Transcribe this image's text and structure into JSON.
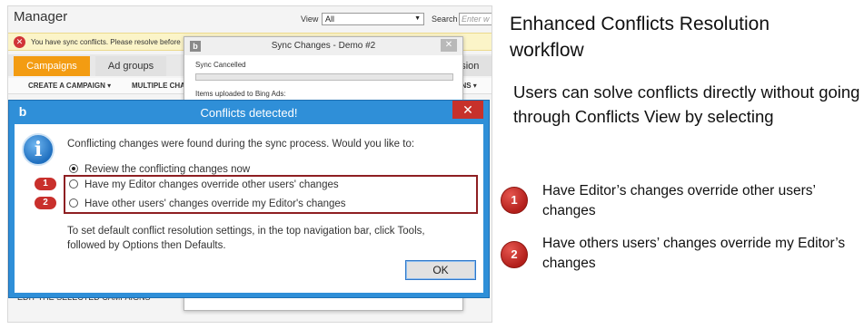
{
  "manager": {
    "title": "Manager",
    "view_label": "View",
    "view_value": "All",
    "search_label": "Search",
    "search_placeholder": "Enter w",
    "notice": "You have sync conflicts. Please resolve before",
    "tabs": [
      "Campaigns",
      "Ad groups",
      "ension"
    ],
    "toolbar": [
      "CREATE A CAMPAIGN ▾",
      "MULTIPLE CHA",
      "UMNS ▾"
    ],
    "bottom_link": "EDIT THE SELECTED CAMPAIGNS"
  },
  "sync_window": {
    "title": "Sync Changes - Demo #2",
    "status": "Sync Cancelled",
    "items": "Items uploaded to Bing Ads:"
  },
  "dialog": {
    "title": "Conflicts detected!",
    "question": "Conflicting changes were found during the sync process. Would you like to:",
    "options": [
      "Review the conflicting changes now",
      "Have my Editor changes override other users' changes",
      "Have other users' changes override my Editor's changes"
    ],
    "badges": [
      "1",
      "2"
    ],
    "hint": "To set default conflict resolution settings, in the top navigation bar, click Tools, followed by Options then Defaults.",
    "ok_label": "OK",
    "close_glyph": "✕"
  },
  "annotation": {
    "heading": "Enhanced Conflicts Resolution workflow",
    "subtext": "Users can solve conflicts directly without going through Conflicts View by selecting",
    "items": [
      {
        "num": "1",
        "text": "Have Editor’s changes override other users’ changes"
      },
      {
        "num": "2",
        "text": "Have others users’ changes override my Editor’s changes"
      }
    ]
  },
  "colors": {
    "dialog_title_bar": "#2f8fd8",
    "close_red": "#c7312b",
    "tab_active": "#f39c12",
    "badge_red": "#c9302c",
    "highlight_box": "#8e1f22"
  }
}
